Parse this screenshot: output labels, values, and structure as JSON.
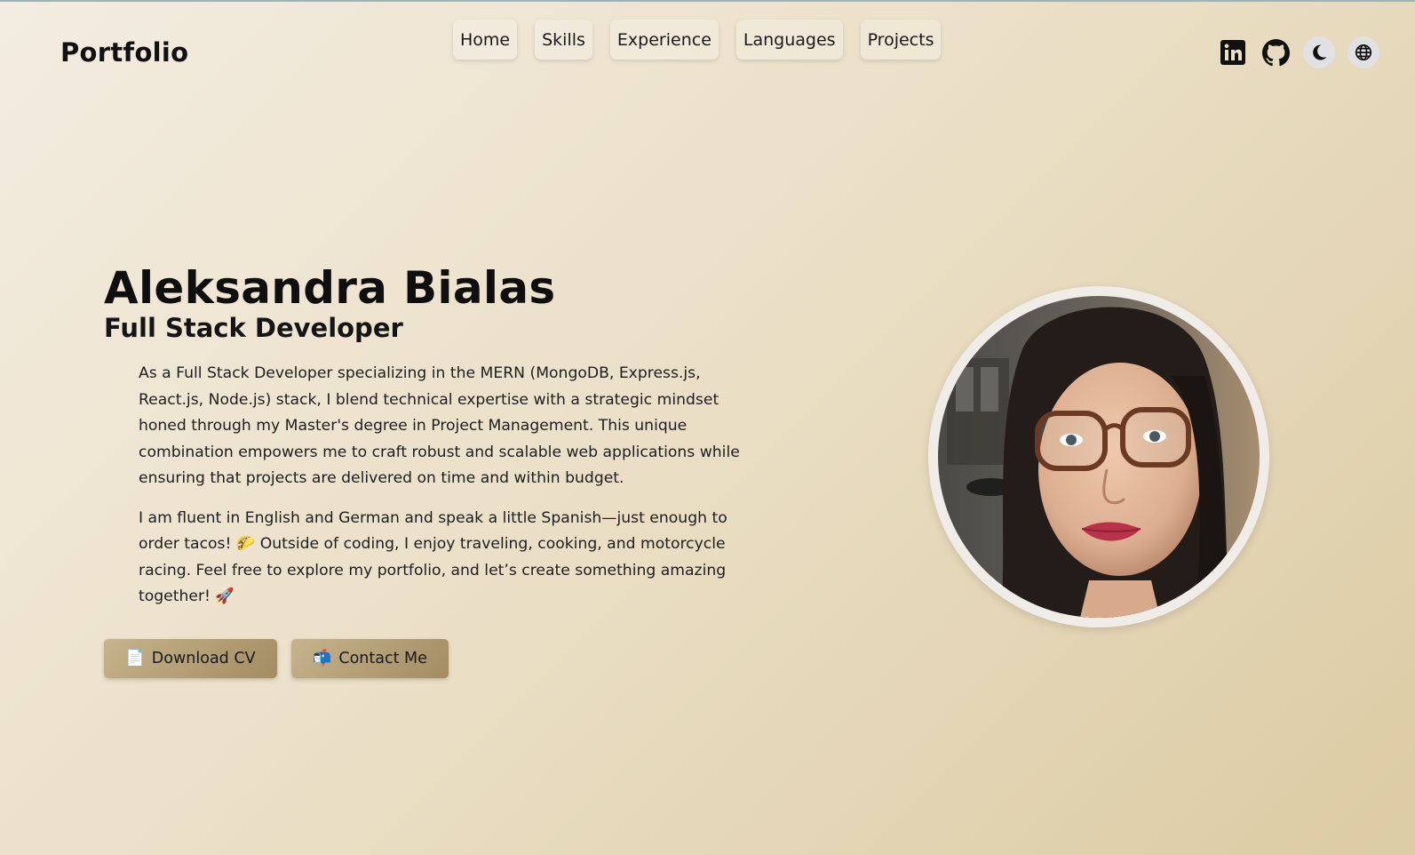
{
  "header": {
    "logo": "Portfolio",
    "nav": [
      "Home",
      "Skills",
      "Experience",
      "Languages",
      "Projects"
    ],
    "icons": [
      "linkedin-icon",
      "github-icon",
      "moon-icon",
      "globe-icon"
    ]
  },
  "hero": {
    "name": "Aleksandra Bialas",
    "role": "Full Stack Developer",
    "paragraph1": "As a Full Stack Developer specializing in the MERN (MongoDB, Express.js, React.js, Node.js) stack, I blend technical expertise with a strategic mindset honed through my Master's degree in Project Management. This unique combination empowers me to craft robust and scalable web applications while ensuring that projects are delivered on time and within budget.",
    "paragraph2": "I am fluent in English and German and speak a little Spanish—just enough to order tacos! 🌮 Outside of coding, I enjoy traveling, cooking, and motorcycle racing. Feel free to explore my portfolio, and let’s create something amazing together! 🚀",
    "download_icon": "📄",
    "download_label": "Download CV",
    "contact_icon": "📬",
    "contact_label": "Contact Me"
  },
  "colors": {
    "bg_start": "#f3ece0",
    "bg_end": "#dccba3",
    "button": "#b5a075"
  }
}
